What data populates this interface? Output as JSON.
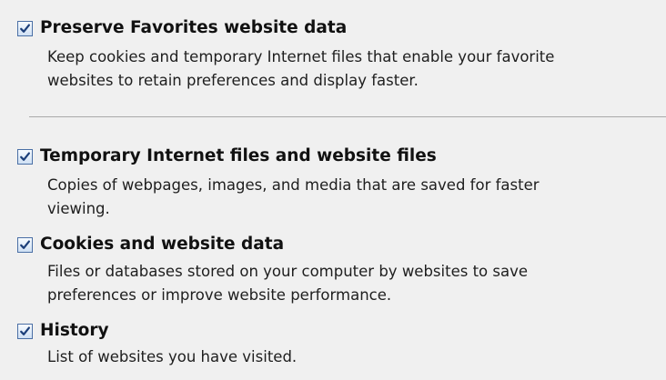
{
  "options": [
    {
      "label": "Preserve Favorites website data",
      "description_lines": [
        "Keep cookies and temporary Internet files that enable your favorite",
        "websites to retain preferences and display faster."
      ],
      "checked": true
    },
    {
      "label": "Temporary Internet files and website files",
      "description_lines": [
        "Copies of webpages, images, and media that are saved for faster",
        "viewing."
      ],
      "checked": true
    },
    {
      "label": "Cookies and website data",
      "description_lines": [
        "Files or databases stored on your computer by websites to save",
        "preferences or improve website performance."
      ],
      "checked": true
    },
    {
      "label": "History",
      "description_lines": [
        "List of websites you have visited."
      ],
      "checked": true
    }
  ],
  "colors": {
    "background": "#f0f0f0",
    "checkbox_border": "#4a6fa5",
    "checkmark": "#1c3f7a",
    "divider": "#a9a9a9"
  },
  "icons": {
    "checkbox_checked": "checkmark-icon"
  }
}
